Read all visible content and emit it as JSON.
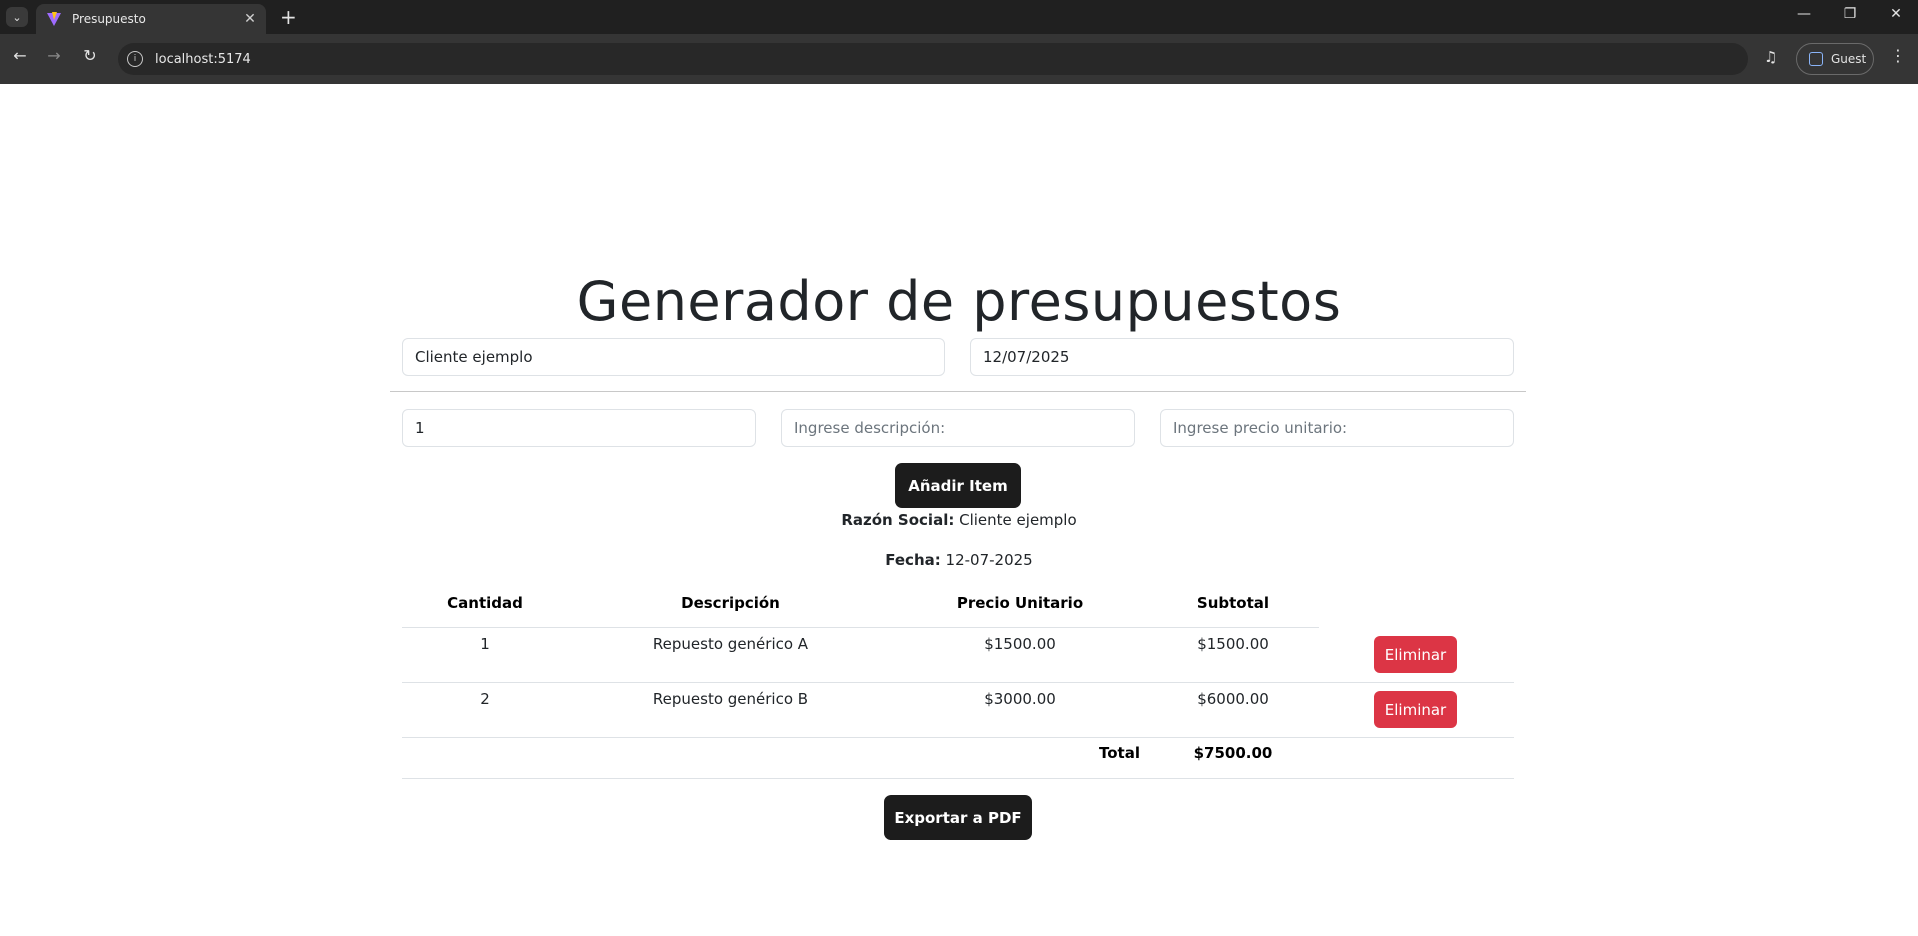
{
  "browser": {
    "tab_title": "Presupuesto",
    "url": "localhost:5174",
    "profile_label": "Guest"
  },
  "page": {
    "title": "Generador de presupuestos",
    "client_input_value": "Cliente ejemplo",
    "date_input_value": "12/07/2025",
    "quantity_input_value": "1",
    "description_placeholder": "Ingrese descripción:",
    "price_placeholder": "Ingrese precio unitario:",
    "add_button_label": "Añadir Item",
    "razon_social_label": "Razón Social:",
    "razon_social_value": "Cliente ejemplo",
    "fecha_label": "Fecha:",
    "fecha_value": "12-07-2025",
    "export_button_label": "Exportar a PDF"
  },
  "table": {
    "headers": [
      "Cantidad",
      "Descripción",
      "Precio Unitario",
      "Subtotal"
    ],
    "rows": [
      {
        "cantidad": "1",
        "descripcion": "Repuesto genérico A",
        "precio": "$1500.00",
        "subtotal": "$1500.00",
        "action": "Eliminar"
      },
      {
        "cantidad": "2",
        "descripcion": "Repuesto genérico B",
        "precio": "$3000.00",
        "subtotal": "$6000.00",
        "action": "Eliminar"
      }
    ],
    "total_label": "Total",
    "total_value": "$7500.00"
  },
  "colors": {
    "danger": "#dc3545",
    "dark_button": "#1c1c1c",
    "text": "#212529"
  }
}
